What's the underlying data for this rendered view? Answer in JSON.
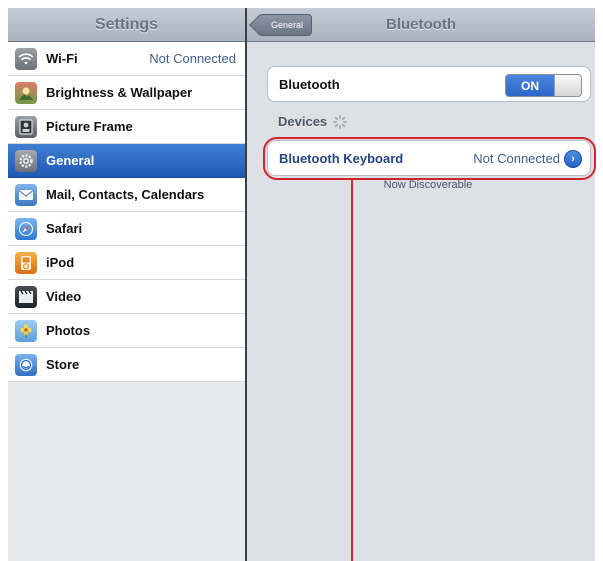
{
  "master": {
    "title": "Settings",
    "items": [
      {
        "label": "Wi-Fi",
        "value": "Not Connected",
        "icon": "wifi-icon",
        "color": "#7b7f85"
      },
      {
        "label": "Brightness & Wallpaper",
        "value": "",
        "icon": "brightness-icon",
        "color": "#5a8a3c"
      },
      {
        "label": "Picture Frame",
        "value": "",
        "icon": "picture-frame-icon",
        "color": "#6e7378"
      },
      {
        "label": "General",
        "value": "",
        "icon": "gear-icon",
        "color": "#7a7f86",
        "selected": true
      },
      {
        "label": "Mail, Contacts, Calendars",
        "value": "",
        "icon": "mail-icon",
        "color": "#4f89c9"
      },
      {
        "label": "Safari",
        "value": "",
        "icon": "safari-icon",
        "color": "#3f86d6"
      },
      {
        "label": "iPod",
        "value": "",
        "icon": "ipod-icon",
        "color": "#e58a1f"
      },
      {
        "label": "Video",
        "value": "",
        "icon": "video-icon",
        "color": "#2a2d33"
      },
      {
        "label": "Photos",
        "value": "",
        "icon": "photos-icon",
        "color": "#e6c23a"
      },
      {
        "label": "Store",
        "value": "",
        "icon": "store-icon",
        "color": "#3b7ed6"
      }
    ]
  },
  "detail": {
    "title": "Bluetooth",
    "back_label": "General",
    "bluetooth_label": "Bluetooth",
    "toggle_on": "ON",
    "devices_header": "Devices",
    "device": {
      "name": "Bluetooth Keyboard",
      "status": "Not Connected"
    },
    "footer": "Now Discoverable"
  },
  "colors": {
    "accent": "#2c66c7",
    "selected_row": "#1f59b4",
    "annotation": "#d3242d"
  }
}
